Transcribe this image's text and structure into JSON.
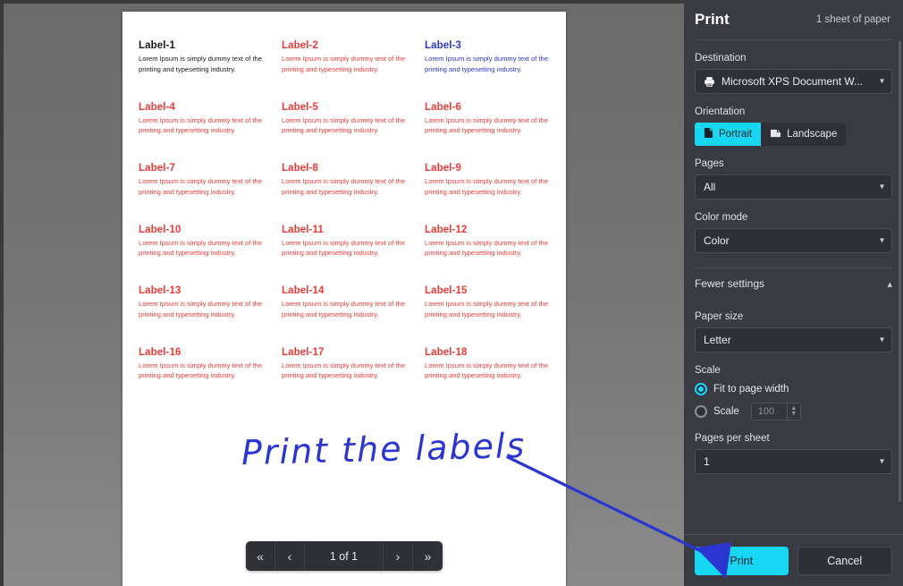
{
  "document": {
    "labels": [
      {
        "title": "Label-1",
        "body": "Lorem Ipsum is simply dummy text of the printing and typesetting industry.",
        "color": "#1a1a1a"
      },
      {
        "title": "Label-2",
        "body": "Lorem Ipsum is simply dummy text of the printing and typesetting industry.",
        "color": "#ee3b37"
      },
      {
        "title": "Label-3",
        "body": "Lorem Ipsum is simply dummy text of the printing and typesetting industry.",
        "color": "#2b35cf"
      },
      {
        "title": "Label-4",
        "body": "Lorem Ipsum is simply dummy text of the printing and typesetting industry.",
        "color": "#ee3b37"
      },
      {
        "title": "Label-5",
        "body": "Lorem Ipsum is simply dummy text of the printing and typesetting industry.",
        "color": "#ee3b37"
      },
      {
        "title": "Label-6",
        "body": "Lorem Ipsum is simply dummy text of the printing and typesetting industry.",
        "color": "#ee3b37"
      },
      {
        "title": "Label-7",
        "body": "Lorem Ipsum is simply dummy text of the printing and typesetting industry.",
        "color": "#ee3b37"
      },
      {
        "title": "Label-8",
        "body": "Lorem Ipsum is simply dummy text of the printing and typesetting industry.",
        "color": "#ee3b37"
      },
      {
        "title": "Label-9",
        "body": "Lorem Ipsum is simply dummy text of the printing and typesetting industry.",
        "color": "#ee3b37"
      },
      {
        "title": "Label-10",
        "body": "Lorem Ipsum is simply dummy text of the printing and typesetting industry.",
        "color": "#ee3b37"
      },
      {
        "title": "Label-11",
        "body": "Lorem Ipsum is simply dummy text of the printing and typesetting industry.",
        "color": "#ee3b37"
      },
      {
        "title": "Label-12",
        "body": "Lorem Ipsum is simply dummy text of the printing and typesetting industry.",
        "color": "#ee3b37"
      },
      {
        "title": "Label-13",
        "body": "Lorem Ipsum is simply dummy text of the printing and typesetting industry.",
        "color": "#ee3b37"
      },
      {
        "title": "Label-14",
        "body": "Lorem Ipsum is simply dummy text of the printing and typesetting industry.",
        "color": "#ee3b37"
      },
      {
        "title": "Label-15",
        "body": "Lorem Ipsum is simply dummy text of the printing and typesetting industry.",
        "color": "#ee3b37"
      },
      {
        "title": "Label-16",
        "body": "Lorem Ipsum is simply dummy text of the printing and typesetting industry.",
        "color": "#ee3b37"
      },
      {
        "title": "Label-17",
        "body": "Lorem Ipsum is simply dummy text of the printing and typesetting industry.",
        "color": "#ee3b37"
      },
      {
        "title": "Label-18",
        "body": "Lorem Ipsum is simply dummy text of the printing and typesetting industry.",
        "color": "#ee3b37"
      }
    ]
  },
  "pagination": {
    "first": "«",
    "prev": "‹",
    "status": "1 of 1",
    "next": "›",
    "last": "»"
  },
  "annotation": {
    "text": "Print the labels",
    "color": "#2b35cf"
  },
  "panel": {
    "title": "Print",
    "sheets": "1 sheet of paper",
    "destination": {
      "label": "Destination",
      "value": "Microsoft XPS Document W...",
      "icon": "printer-icon"
    },
    "orientation": {
      "label": "Orientation",
      "portrait": "Portrait",
      "landscape": "Landscape",
      "selected": "Portrait"
    },
    "pages": {
      "label": "Pages",
      "value": "All"
    },
    "color_mode": {
      "label": "Color mode",
      "value": "Color"
    },
    "fewer_settings": {
      "label": "Fewer settings",
      "caret": "⌃"
    },
    "paper_size": {
      "label": "Paper size",
      "value": "Letter"
    },
    "scale": {
      "label": "Scale",
      "fit_option": "Fit to page width",
      "scale_option": "Scale",
      "scale_value": "100",
      "selected": "Fit to page width"
    },
    "pages_per_sheet": {
      "label": "Pages per sheet",
      "value": "1"
    },
    "buttons": {
      "print": "Print",
      "cancel": "Cancel"
    },
    "accent": "#18d7f5"
  }
}
